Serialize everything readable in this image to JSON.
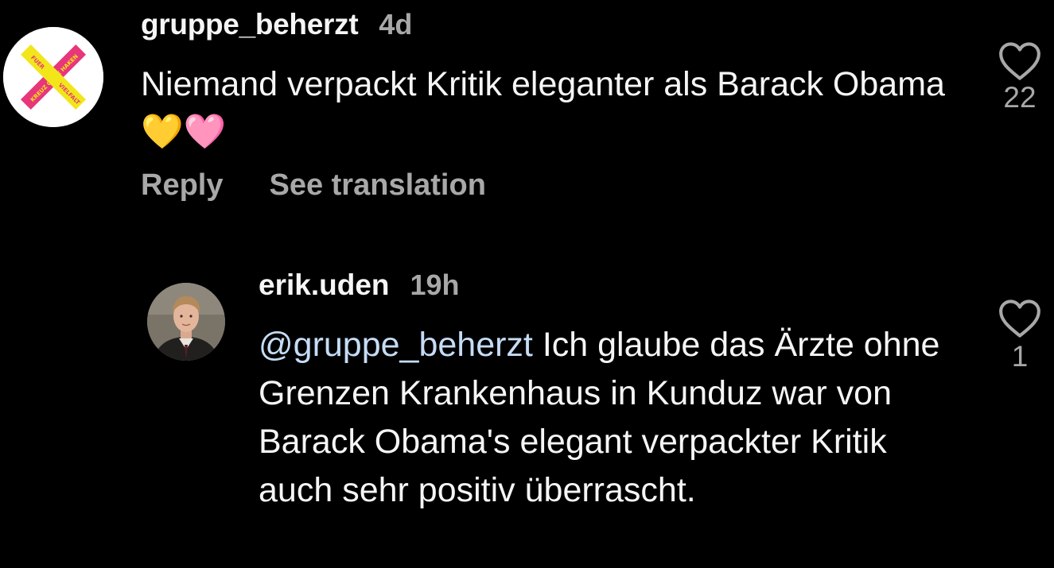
{
  "comments": [
    {
      "username": "gruppe_beherzt",
      "time": "4d",
      "text": "Niemand verpackt Kritik eleganter als Barack Obama",
      "emoji": "💛🩷",
      "reply_label": "Reply",
      "translate_label": "See translation",
      "likes": "22",
      "avatar_logo_text": [
        "FUER",
        "KREUZ OHNE HAKEN",
        "VIELFALT"
      ]
    },
    {
      "username": "erik.uden",
      "time": "19h",
      "mention": "@gruppe_beherzt",
      "text": " Ich glaube das Ärzte ohne Grenzen Krankenhaus in Kunduz war von Barack Obama's elegant verpackter Kritik auch sehr positiv überrascht.",
      "likes": "1"
    }
  ],
  "colors": {
    "background": "#000000",
    "primary_text": "#f5f5f5",
    "secondary_text": "#a8a8a8",
    "mention": "#c5dcf5",
    "logo_yellow": "#f2e61b",
    "logo_pink": "#e8367a"
  },
  "icons": {
    "like": "heart-outline-icon"
  }
}
